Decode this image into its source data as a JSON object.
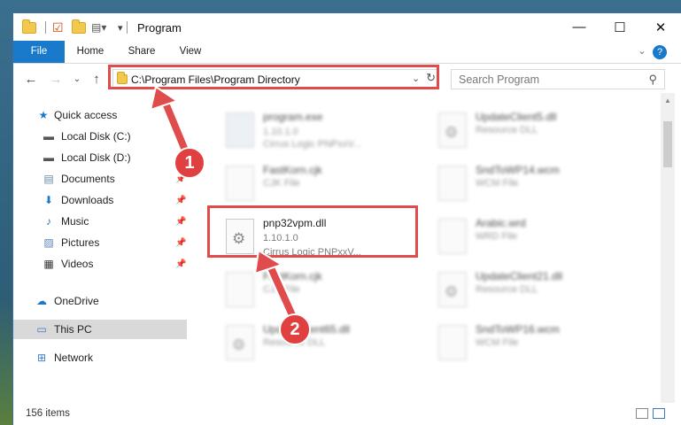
{
  "window": {
    "title": "Program",
    "controls": {
      "minimize": "—",
      "maximize": "☐",
      "close": "✕"
    }
  },
  "ribbon": {
    "tabs": [
      "File",
      "Home",
      "Share",
      "View"
    ],
    "help": "?"
  },
  "nav": {
    "address": "C:\\Program Files\\Program Directory",
    "search_placeholder": "Search Program"
  },
  "sidebar": {
    "items": [
      {
        "label": "Quick access",
        "icon": "star-icon"
      },
      {
        "label": "Local Disk (C:)",
        "icon": "drive-icon"
      },
      {
        "label": "Local Disk (D:)",
        "icon": "drive-icon"
      },
      {
        "label": "Documents",
        "icon": "documents-icon"
      },
      {
        "label": "Downloads",
        "icon": "download-icon"
      },
      {
        "label": "Music",
        "icon": "music-icon"
      },
      {
        "label": "Pictures",
        "icon": "pictures-icon"
      },
      {
        "label": "Videos",
        "icon": "videos-icon"
      },
      {
        "label": "OneDrive",
        "icon": "cloud-icon"
      },
      {
        "label": "This PC",
        "icon": "computer-icon"
      },
      {
        "label": "Network",
        "icon": "network-icon"
      }
    ]
  },
  "files": [
    {
      "name": "program.exe",
      "line2": "1.10.1.0",
      "line3": "Cirrus Logic PNPxxV..."
    },
    {
      "name": "UpdateClient5.dll",
      "line2": "Resource DLL",
      "line3": ""
    },
    {
      "name": "FastKorn.cjk",
      "line2": "CJK File",
      "line3": ""
    },
    {
      "name": "SndToWP14.wcm",
      "line2": "WCM File",
      "line3": ""
    },
    {
      "name": "pnp32vpm.dll",
      "line2": "1.10.1.0",
      "line3": "Cirrus Logic PNPxxV..."
    },
    {
      "name": "Arabic.wrd",
      "line2": "WRD File",
      "line3": ""
    },
    {
      "name": "FastKorn.cjk",
      "line2": "CJK File",
      "line3": ""
    },
    {
      "name": "UpdateClient21.dll",
      "line2": "Resource DLL",
      "line3": ""
    },
    {
      "name": "UpdateClient65.dll",
      "line2": "Resource DLL",
      "line3": ""
    },
    {
      "name": "SndToWP16.wcm",
      "line2": "WCM File",
      "line3": ""
    }
  ],
  "status": {
    "item_count": "156 items"
  },
  "annotations": {
    "step1": "1",
    "step2": "2",
    "color": "#e04c4c"
  }
}
